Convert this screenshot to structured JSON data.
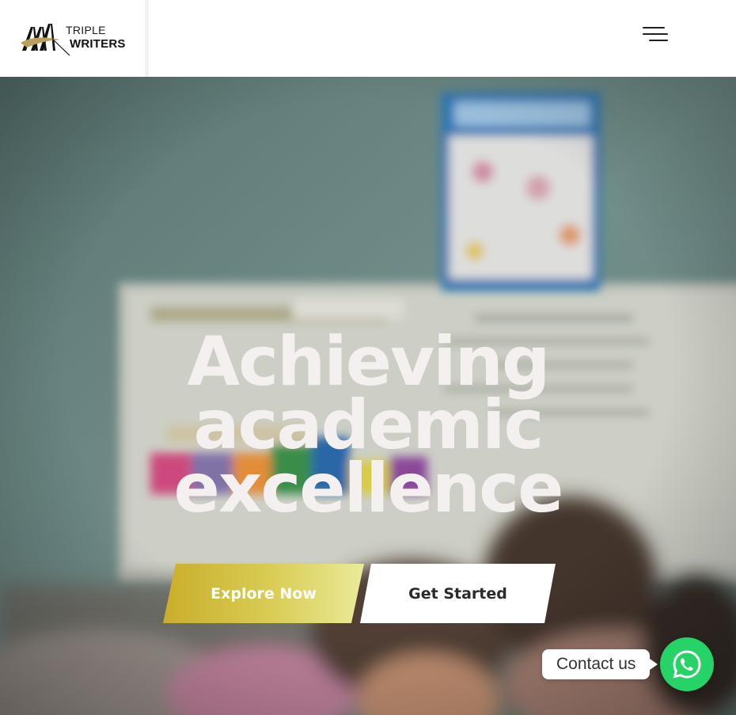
{
  "header": {
    "logo": {
      "line1": "TRIPLE",
      "line2": "WRITERS"
    },
    "menu_icon": "hamburger-menu-icon"
  },
  "hero": {
    "title_lines": [
      "Achieving",
      "academic",
      "excellence"
    ],
    "buttons": {
      "explore_label": "Explore Now",
      "start_label": "Get Started"
    }
  },
  "contact": {
    "label": "Contact us",
    "icon": "whatsapp-icon"
  },
  "colors": {
    "accent_gold": "#c9ae2a",
    "accent_light": "#eaea99",
    "whatsapp_green": "#25d366",
    "title_text": "#f4f0ef"
  }
}
